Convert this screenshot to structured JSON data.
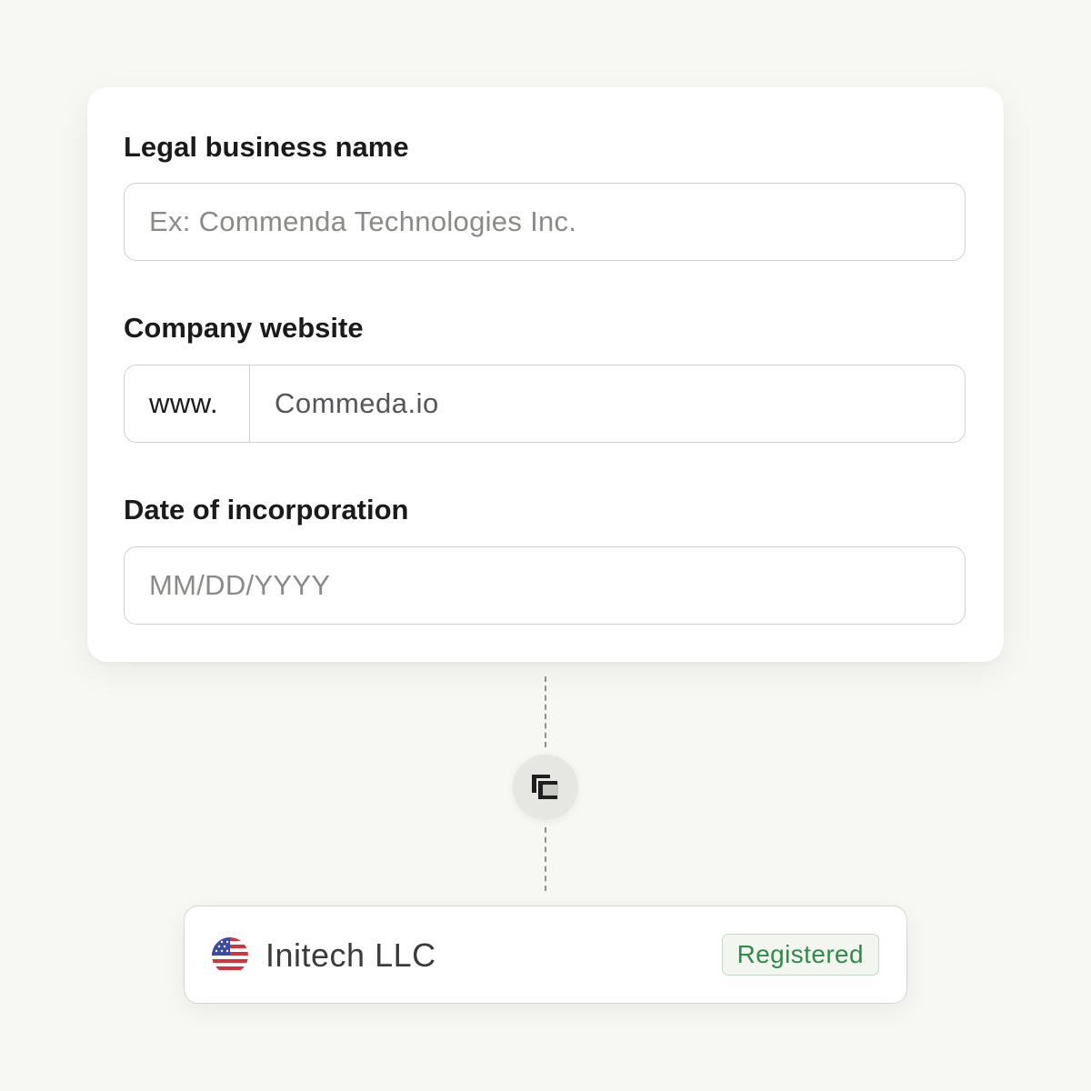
{
  "form": {
    "legal_name": {
      "label": "Legal business name",
      "placeholder": "Ex: Commenda Technologies Inc."
    },
    "website": {
      "label": "Company website",
      "prefix": "www.",
      "value": "Commeda.io"
    },
    "incorporation_date": {
      "label": "Date of incorporation",
      "placeholder": "MM/DD/YYYY"
    }
  },
  "connector": {
    "icon": "commenda-logo-icon"
  },
  "entity": {
    "flag_icon": "us-flag-icon",
    "name": "Initech LLC",
    "status": "Registered",
    "status_color": "#2f8a4c"
  }
}
